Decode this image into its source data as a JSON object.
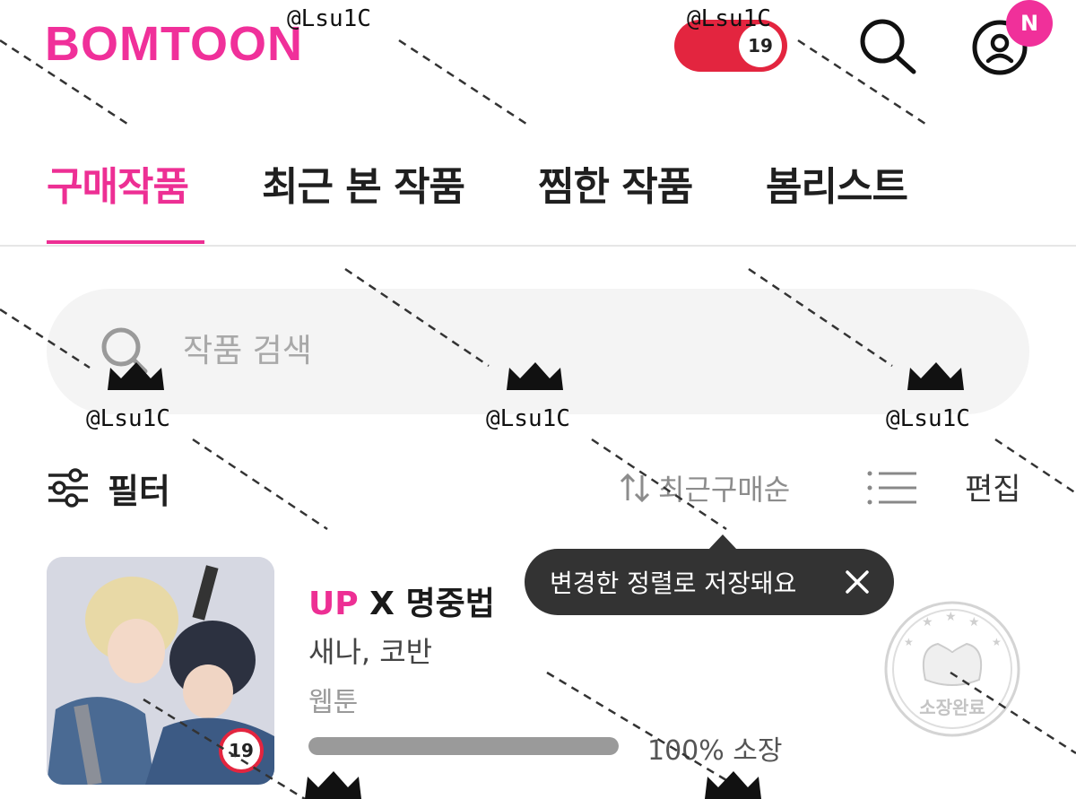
{
  "header": {
    "logo": "BOMTOON",
    "adult_toggle_label": "19",
    "new_badge": "N"
  },
  "tabs": [
    {
      "label": "구매작품",
      "active": true
    },
    {
      "label": "최근 본 작품",
      "active": false
    },
    {
      "label": "찜한 작품",
      "active": false
    },
    {
      "label": "봄리스트",
      "active": false
    }
  ],
  "search": {
    "placeholder": "작품 검색",
    "value": ""
  },
  "toolbar": {
    "filter_label": "필터",
    "sort_label": "최근구매순",
    "edit_label": "편집"
  },
  "tooltip": {
    "text": "변경한 정렬로 저장돼요"
  },
  "items": [
    {
      "tag": "UP",
      "title": "X 명중법",
      "authors": "새나, 코반",
      "category": "웹툰",
      "age_rating": "19",
      "progress_percent": 100,
      "progress_label": "100% 소장"
    }
  ],
  "watermark": {
    "handle": "@Lsu1C",
    "stamp_text": "소장완료"
  },
  "colors": {
    "brand_pink": "#ed2f94",
    "adult_red": "#e3253f",
    "tooltip_bg": "#333333"
  }
}
